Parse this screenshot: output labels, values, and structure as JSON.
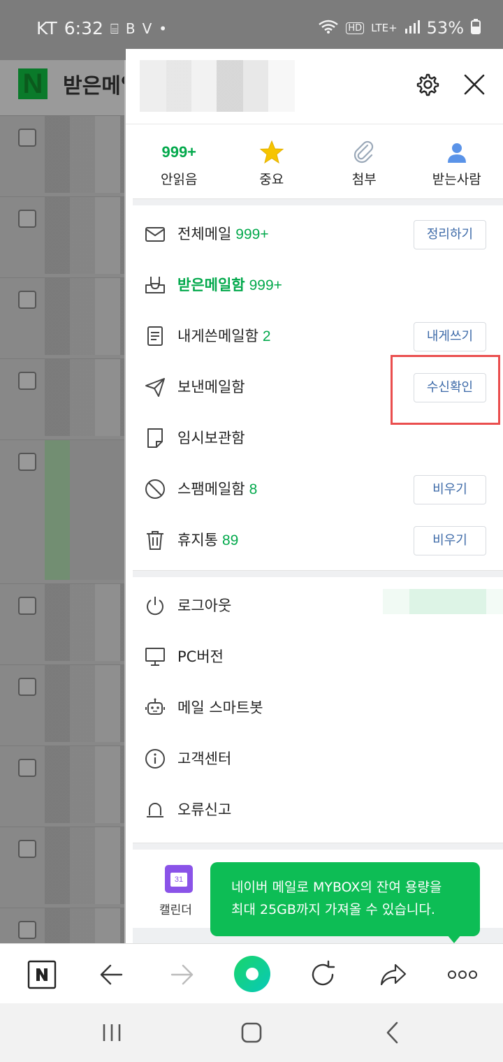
{
  "status_bar": {
    "carrier": "KT",
    "time": "6:32",
    "battery": "53%",
    "network": "LTE+"
  },
  "background_app": {
    "title": "받은메일"
  },
  "drawer": {
    "quick_filters": [
      {
        "count": "999+",
        "label": "안읽음",
        "icon": "unread-count"
      },
      {
        "label": "중요",
        "icon": "star-icon",
        "color": "#f6c400"
      },
      {
        "label": "첨부",
        "icon": "paperclip-icon"
      },
      {
        "label": "받는사람",
        "icon": "person-icon",
        "color": "#5a93e8"
      }
    ],
    "mailboxes": [
      {
        "label": "전체메일",
        "count": "999+",
        "icon": "envelope-icon",
        "button": "정리하기"
      },
      {
        "label": "받은메일함",
        "count": "999+",
        "icon": "inbox-icon",
        "active": true
      },
      {
        "label": "내게쓴메일함",
        "count": "2",
        "icon": "note-icon",
        "button": "내게쓰기"
      },
      {
        "label": "보낸메일함",
        "icon": "paper-plane-icon",
        "button": "수신확인"
      },
      {
        "label": "임시보관함",
        "icon": "draft-icon"
      },
      {
        "label": "스팸메일함",
        "count": "8",
        "icon": "ban-icon",
        "button": "비우기"
      },
      {
        "label": "휴지통",
        "count": "89",
        "icon": "trash-icon",
        "button": "비우기"
      }
    ],
    "settings_menu": [
      {
        "label": "로그아웃",
        "icon": "power-icon"
      },
      {
        "label": "PC버전",
        "icon": "monitor-icon"
      },
      {
        "label": "메일 스마트봇",
        "icon": "robot-icon"
      },
      {
        "label": "고객센터",
        "icon": "info-icon"
      },
      {
        "label": "오류신고",
        "icon": "siren-icon"
      }
    ],
    "calendar": {
      "label": "캘린더",
      "day": "31"
    },
    "toast": {
      "line1": "네이버 메일로 MYBOX의 잔여 용량을",
      "line2": "최대 25GB까지 가져올 수 있습니다."
    }
  },
  "colors": {
    "accent_green": "#03a94c",
    "button_text": "#3d6aa8",
    "highlight_red": "#ea4e4e",
    "toast_green": "#0dbd55"
  }
}
